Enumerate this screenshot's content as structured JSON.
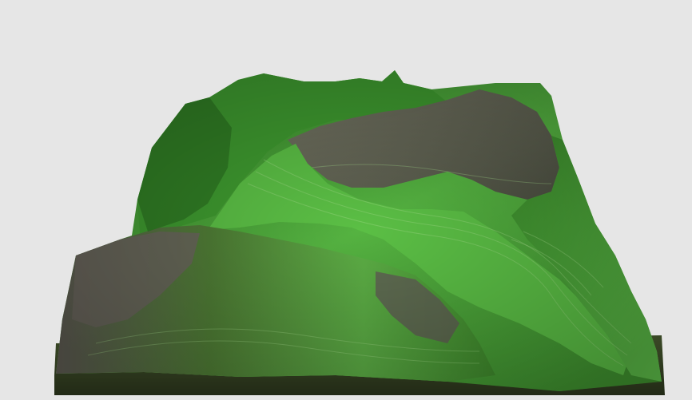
{
  "scene": {
    "subject": "3d-terrain-relief",
    "colors": {
      "background": "#e6e6e6",
      "valley_green": "#3f9a2f",
      "bright_green": "#5ec24a",
      "dark_green": "#1f4f16",
      "rock_gray": "#6f6a62",
      "rock_dark": "#4a4640",
      "base_edge": "#2c3a1c"
    }
  }
}
